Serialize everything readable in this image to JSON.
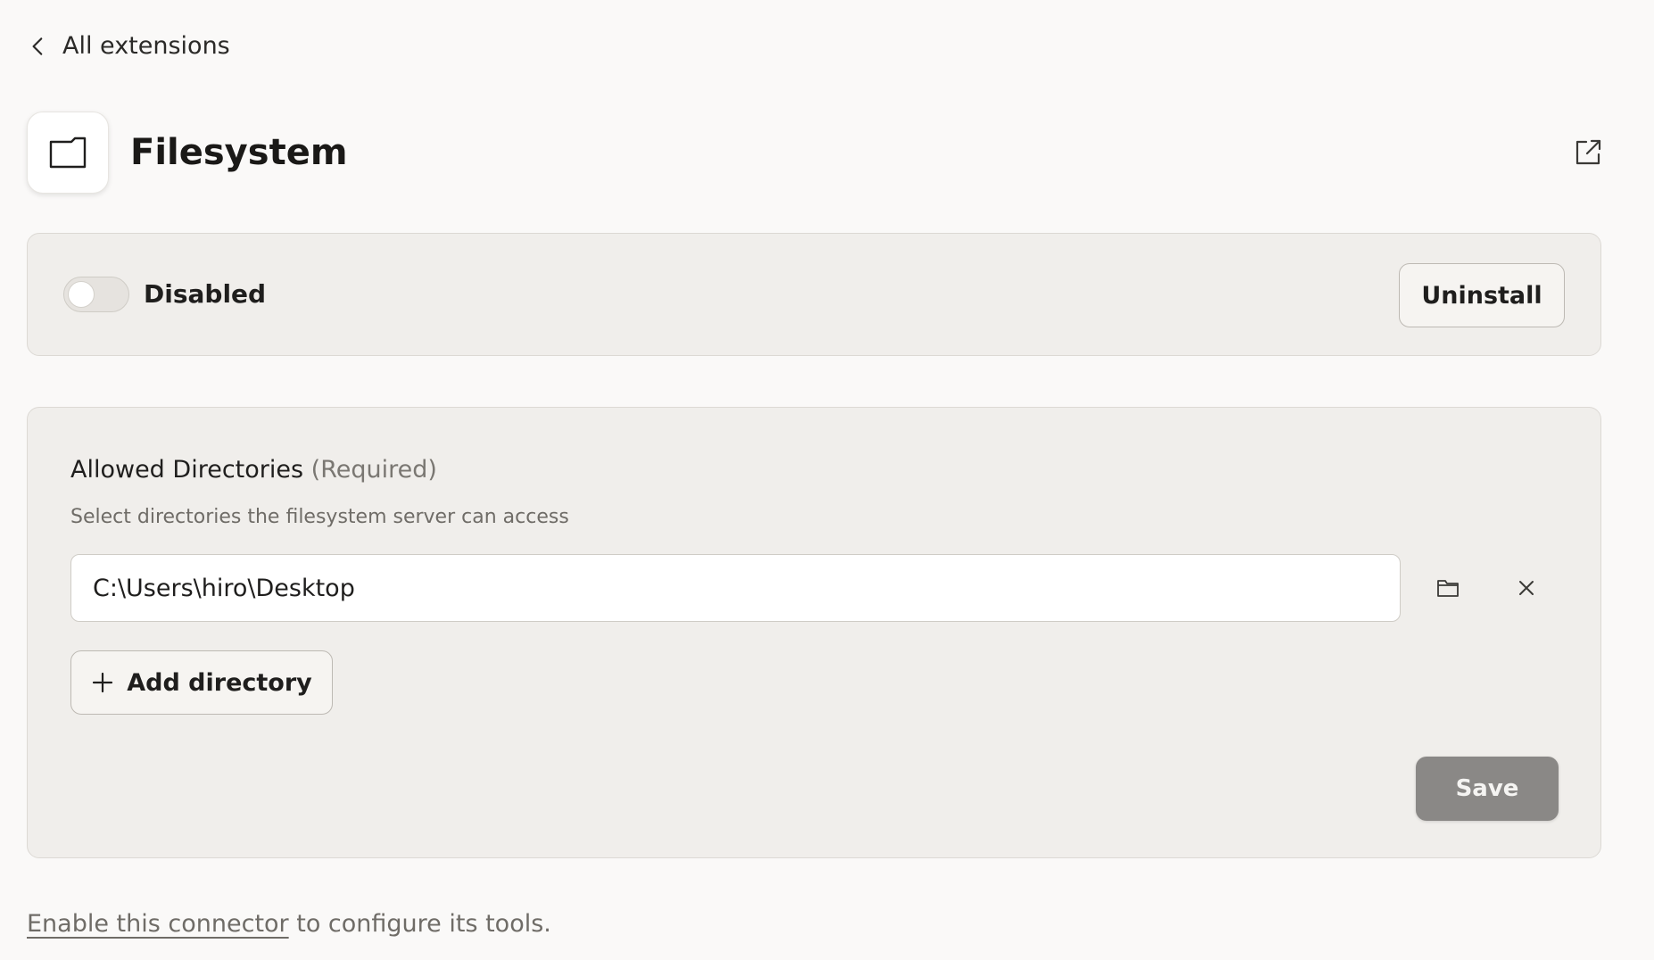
{
  "nav": {
    "back_label": "All extensions"
  },
  "extension": {
    "name": "Filesystem",
    "icon": "folder-icon"
  },
  "status": {
    "toggle_label": "Disabled",
    "enabled": false,
    "uninstall_label": "Uninstall"
  },
  "config": {
    "field_label": "Allowed Directories",
    "required_tag": "(Required)",
    "help_text": "Select directories the filesystem server can access",
    "directories": [
      "C:\\Users\\hiro\\Desktop"
    ],
    "add_label": "Add directory",
    "save_label": "Save"
  },
  "footer": {
    "link_text": "Enable this connector",
    "rest_text": " to configure its tools."
  },
  "colors": {
    "background": "#faf9f8",
    "card": "#f0eeeb",
    "save_disabled": "#8a8886"
  }
}
